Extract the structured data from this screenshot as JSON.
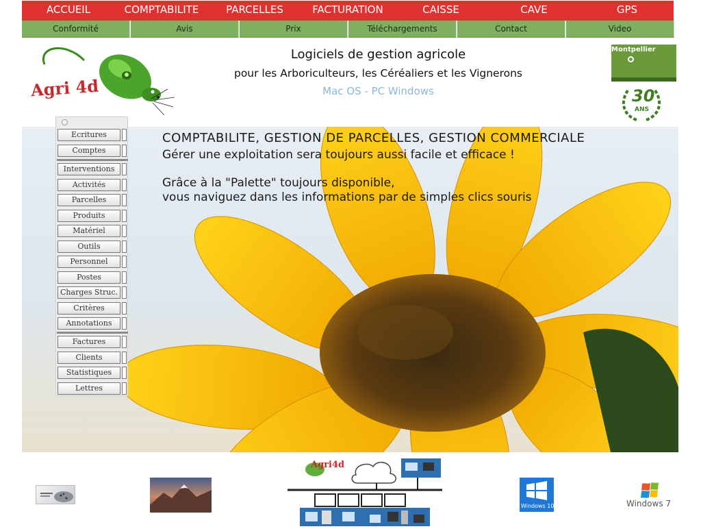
{
  "topnav": [
    "ACCUEIL",
    "COMPTABILITE",
    "PARCELLES",
    "FACTURATION",
    "CAISSE",
    "CAVE",
    "GPS"
  ],
  "subnav": [
    "Conformité",
    "Avis",
    "Prix",
    "Téléchargements",
    "Contact",
    "Video"
  ],
  "logo": {
    "text": "Agri 4d"
  },
  "header": {
    "title": "Logiciels de gestion agricole",
    "subtitle": "pour les Arboriculteurs, les Céréaliers et les Vignerons",
    "os": "Mac OS - PC Windows"
  },
  "badges": {
    "montpellier": "Montpellier",
    "anniversary": "30",
    "anniversary_unit": "ANS"
  },
  "hero": {
    "heading": "COMPTABILITE, GESTION DE PARCELLES, GESTION COMMERCIALE",
    "line1": "Gérer une exploitation sera toujours aussi facile et efficace !",
    "line2": "Grâce à la \"Palette\" toujours disponible,",
    "line3": "vous naviguez dans les informations par de simples clics souris"
  },
  "palette": {
    "group1": [
      "Ecritures",
      "Comptes"
    ],
    "group2": [
      "Interventions",
      "Activités",
      "Parcelles",
      "Produits",
      "Matériel",
      "Outils",
      "Personnel",
      "Postes",
      "Charges Struc.",
      "Critères",
      "Annotations"
    ],
    "group3": [
      "Factures",
      "Clients",
      "Statistiques",
      "Lettres"
    ]
  },
  "bottom": {
    "diagram_logo": "Agri4d",
    "win10": "Windows 10",
    "win7": "Windows 7"
  },
  "colors": {
    "nav_red": "#e03131",
    "nav_green": "#7fb05f",
    "os_blue": "#8ab8dc",
    "sunflower": "#f2b705"
  }
}
